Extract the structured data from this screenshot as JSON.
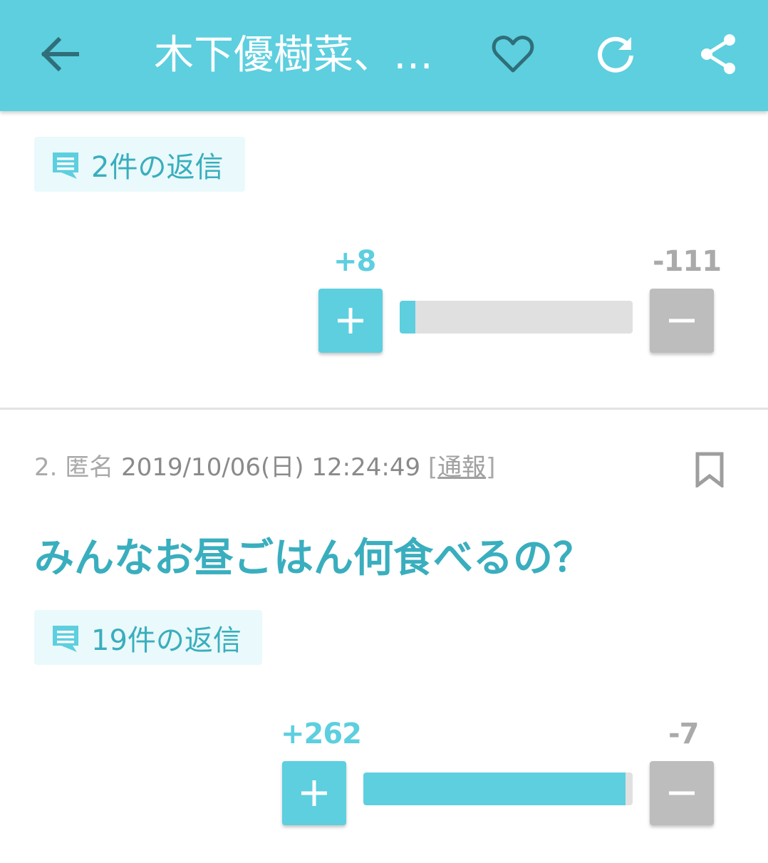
{
  "header": {
    "title": "木下優樹菜、…",
    "icons": [
      "arrow-back-icon",
      "heart-outline-icon",
      "refresh-icon",
      "share-icon"
    ]
  },
  "colors": {
    "accent": "#5dcfdf",
    "accent_dark": "#39aebe",
    "chip_bg": "#eaf9fb",
    "minus_gray": "#bdbdbd"
  },
  "comments": [
    {
      "replies_label": "2件の返信",
      "plus": "+8",
      "minus": "-111",
      "plus_ratio": 0.067
    },
    {
      "number": "2.",
      "author": "匿名",
      "datetime": "2019/10/06(日) 12:24:49",
      "report_open": "[",
      "report_label": "通報",
      "report_close": "]",
      "body": "みんなお昼ごはん何食べるの？",
      "replies_label": "19件の返信",
      "plus": "+262",
      "minus": "-7",
      "plus_ratio": 0.974
    }
  ]
}
